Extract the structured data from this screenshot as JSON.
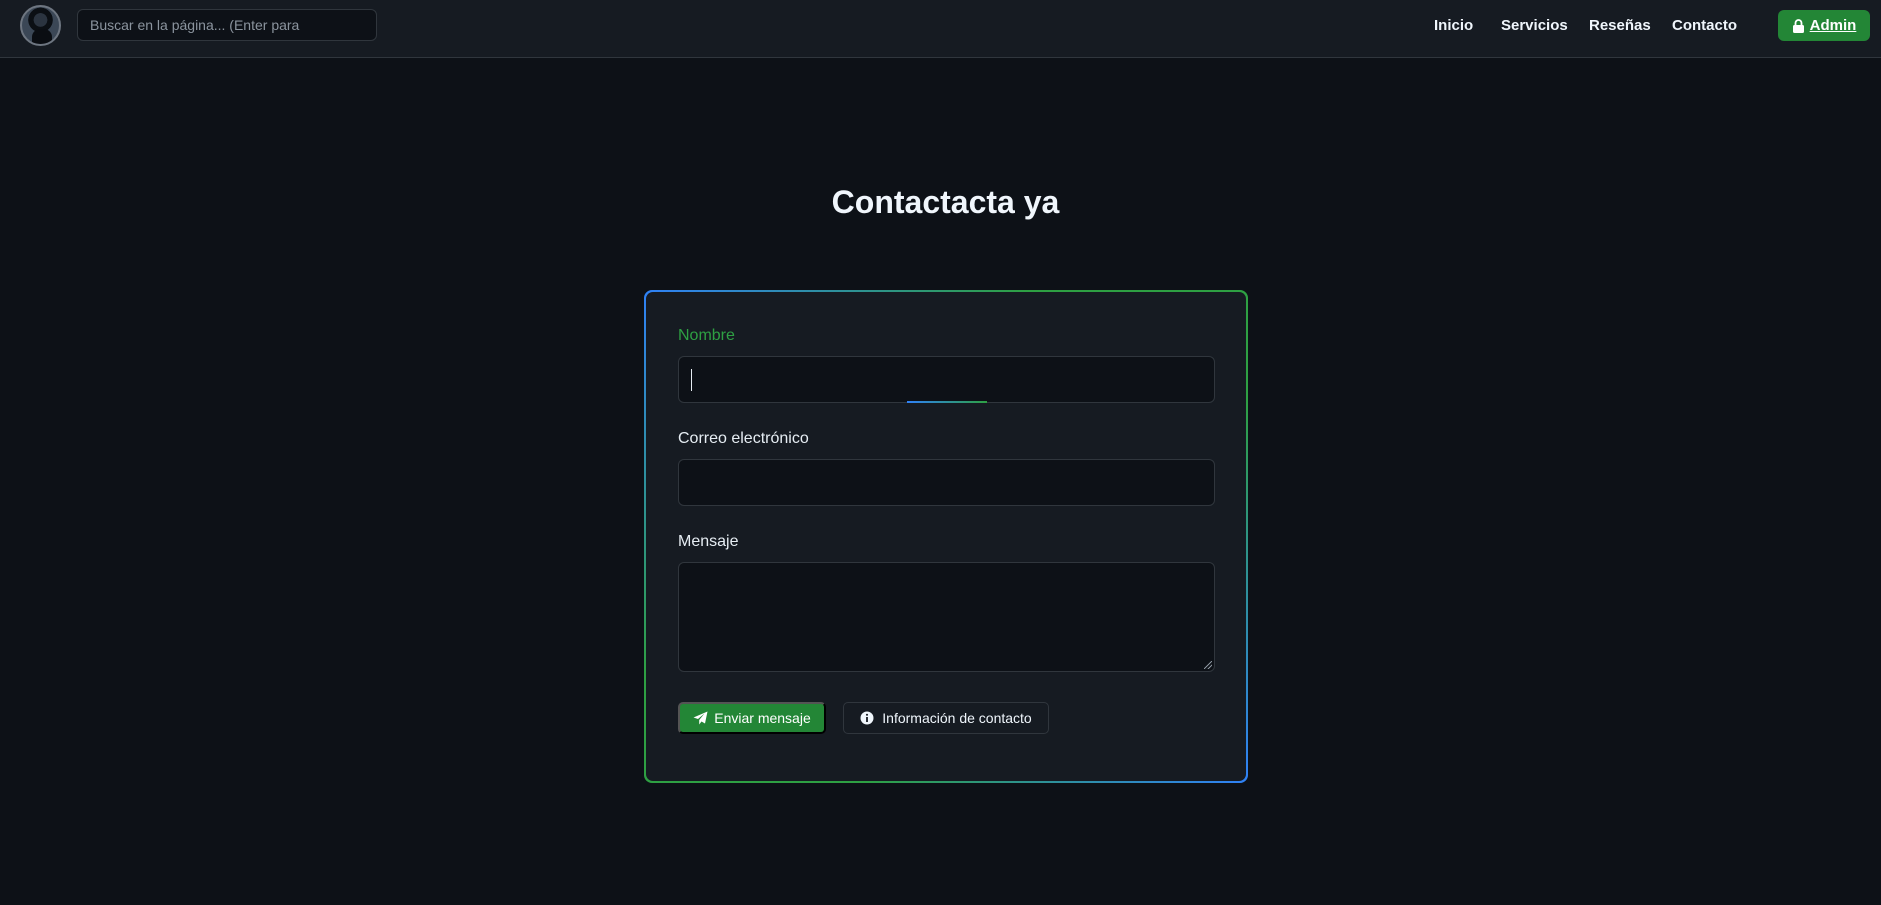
{
  "navbar": {
    "search_placeholder": "Buscar en la página... (Enter para",
    "links": [
      "Inicio",
      "Servicios",
      "Reseñas",
      "Contacto"
    ],
    "admin_label": "Admin"
  },
  "page": {
    "title": "Contactacta ya"
  },
  "form": {
    "name_label": "Nombre",
    "name_value": "",
    "email_label": "Correo electrónico",
    "email_value": "",
    "message_label": "Mensaje",
    "message_value": "",
    "send_label": "Enviar mensaje",
    "info_label": "Información de contacto"
  },
  "colors": {
    "background": "#0d1117",
    "navbar": "#161b22",
    "accent_green": "#238636",
    "accent_blue": "#2f81f7"
  },
  "icons": {
    "avatar": "avatar",
    "admin": "lock-icon",
    "send": "paper-plane-icon",
    "info": "info-circle-icon"
  }
}
